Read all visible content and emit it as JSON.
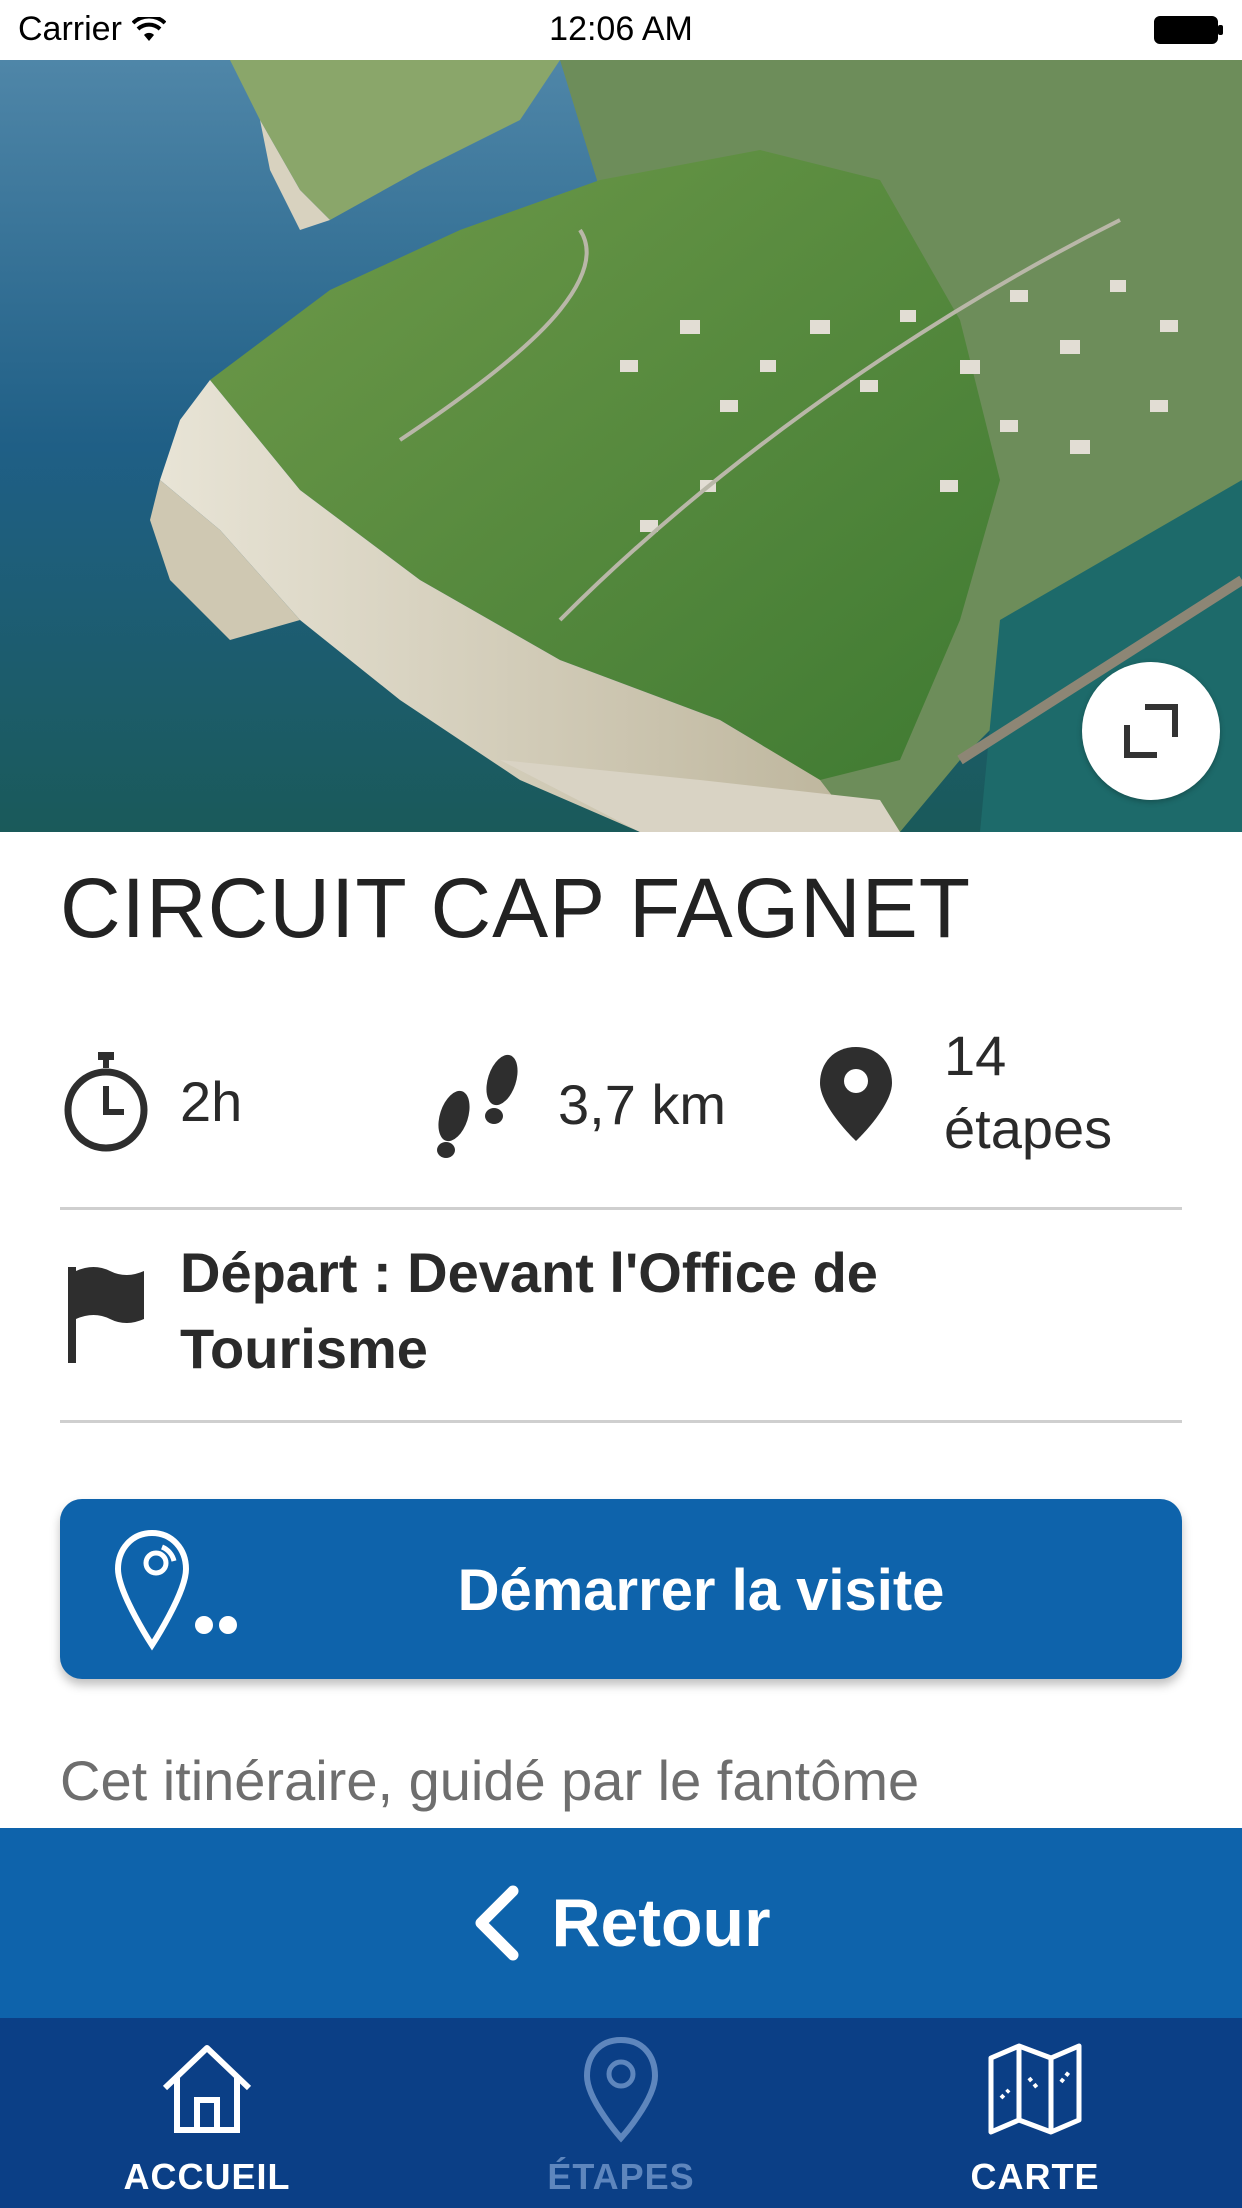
{
  "status_bar": {
    "carrier": "Carrier",
    "time": "12:06 AM"
  },
  "hero": {
    "expand_icon": "expand-icon"
  },
  "title": "CIRCUIT CAP FAGNET",
  "stats": {
    "duration": "2h",
    "distance": "3,7 km",
    "steps_count": "14",
    "steps_label": "étapes"
  },
  "depart": {
    "line1": "Départ : Devant l'Office de",
    "line2": "Tourisme"
  },
  "start_button": {
    "label": "Démarrer la visite"
  },
  "intro_text": "Cet itinéraire, guidé par le fantôme",
  "back_button": {
    "label": "Retour"
  },
  "tabs": [
    {
      "label": "ACCUEIL",
      "icon": "home-icon",
      "active": true
    },
    {
      "label": "ÉTAPES",
      "icon": "location-pin-icon",
      "active": false
    },
    {
      "label": "CARTE",
      "icon": "map-icon",
      "active": true
    }
  ],
  "colors": {
    "primary_blue": "#0e63ab",
    "tabbar_blue": "#0b3f86",
    "inactive_tab": "#5e86bd"
  }
}
